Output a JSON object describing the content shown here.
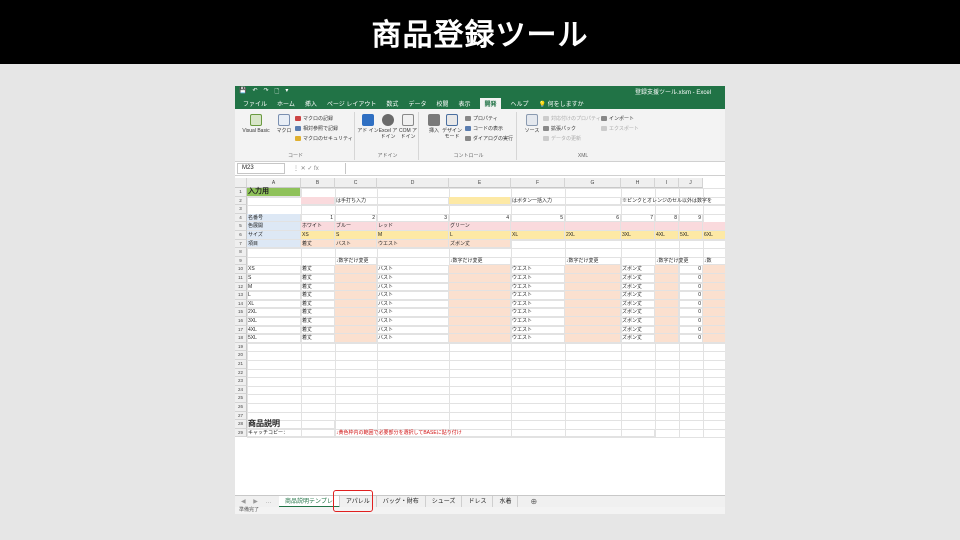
{
  "slide_title": "商品登録ツール",
  "excel": {
    "quick_access": [
      "💾",
      "↶",
      "↷",
      "🗋",
      "▾"
    ],
    "window_title": "登録支援ツール.xlsm - Excel",
    "menu": [
      "ファイル",
      "ホーム",
      "挿入",
      "ページ レイアウト",
      "数式",
      "データ",
      "校閲",
      "表示",
      "開発",
      "ヘルプ",
      "💡 何をしますか"
    ],
    "active_menu_index": 8,
    "ribbon": {
      "code_group_label": "コード",
      "visual_basic": "Visual Basic",
      "macro": "マクロ",
      "record_macro": "マクロの記録",
      "relative_ref": "相対参照で記録",
      "macro_security": "マクロのセキュリティ",
      "addin": "アド イン",
      "excel_addin": "Excel アドイン",
      "com_addin": "COM アドイン",
      "addin_group_label": "アドイン",
      "insert": "挿入",
      "design_mode": "デザイン モード",
      "properties": "プロパティ",
      "view_code": "コードの表示",
      "run_dialog": "ダイアログの実行",
      "controls_group_label": "コントロール",
      "source": "ソース",
      "map_props": "対応付けのプロパティ",
      "expansion_pack": "拡張パック",
      "refresh_data": "データの更新",
      "import": "インポート",
      "export": "エクスポート",
      "xml_group_label": "XML"
    },
    "name_box": "M23",
    "fx_icons": "⋮  ✕  ✓  fx",
    "columns": [
      "A",
      "B",
      "C",
      "D",
      "E",
      "F",
      "G",
      "H",
      "I",
      "J"
    ],
    "rows": [
      "1",
      "2",
      "3",
      "4",
      "5",
      "6",
      "7",
      "8",
      "9",
      "10",
      "11",
      "12",
      "13",
      "14",
      "15",
      "16",
      "17",
      "18",
      "19",
      "20",
      "21",
      "22",
      "23",
      "24",
      "25",
      "26",
      "27",
      "28",
      "29"
    ],
    "cells": {
      "a1": "入力用",
      "c2": "は手打ち入力",
      "f2": "はボタン一括入力",
      "h2": "※ピンクとオレンジのセル以外は数字を",
      "r4": [
        "名番号",
        "1",
        "2",
        "3",
        "4",
        "5",
        "6",
        "7",
        "8",
        "9"
      ],
      "r5": [
        "色展開",
        "ホワイト",
        "ブルー",
        "レッド",
        "グリーン"
      ],
      "r6": [
        "サイズ",
        "XS",
        "S",
        "M",
        "L",
        "XL",
        "2XL",
        "3XL",
        "4XL",
        "5XL",
        "6XL"
      ],
      "r7": [
        "項目",
        "着丈",
        "バスト",
        "ウエスト",
        "ズボン丈"
      ],
      "r9": [
        "↓数字だけ変更",
        "↓数字だけ変更",
        "↓数字だけ変更",
        "↓数字だけ変更",
        "↓数"
      ],
      "size_rows": [
        "XS",
        "S",
        "M",
        "L",
        "XL",
        "2XL",
        "3XL",
        "4XL",
        "5XL"
      ],
      "row_item_b": "着丈",
      "row_item_d": "バスト",
      "row_item_f": "ウエスト",
      "row_item_h": "ズボン丈",
      "row_zero": "0",
      "a28": "商品説明",
      "a29": "キャッチコピー：",
      "c29": "↓黄色枠内の範囲で必要部分を選択してBASEに貼り付け"
    },
    "sheet_nav": "◀ ▶ …",
    "sheets": [
      "商品説明テンプレ",
      "アパレル",
      "バッグ・財布",
      "シューズ",
      "ドレス",
      "水着"
    ],
    "active_sheet_index": 0,
    "add_sheet": "⊕",
    "status": "準備完了"
  },
  "colors": {
    "excel_green": "#217346",
    "pink": "#fadadd",
    "yellow": "#fde9a5",
    "blue": "#dde8f5",
    "salmon": "#fbe0cf",
    "green_cell": "#8fc25a",
    "highlight_red": "#e02020"
  }
}
